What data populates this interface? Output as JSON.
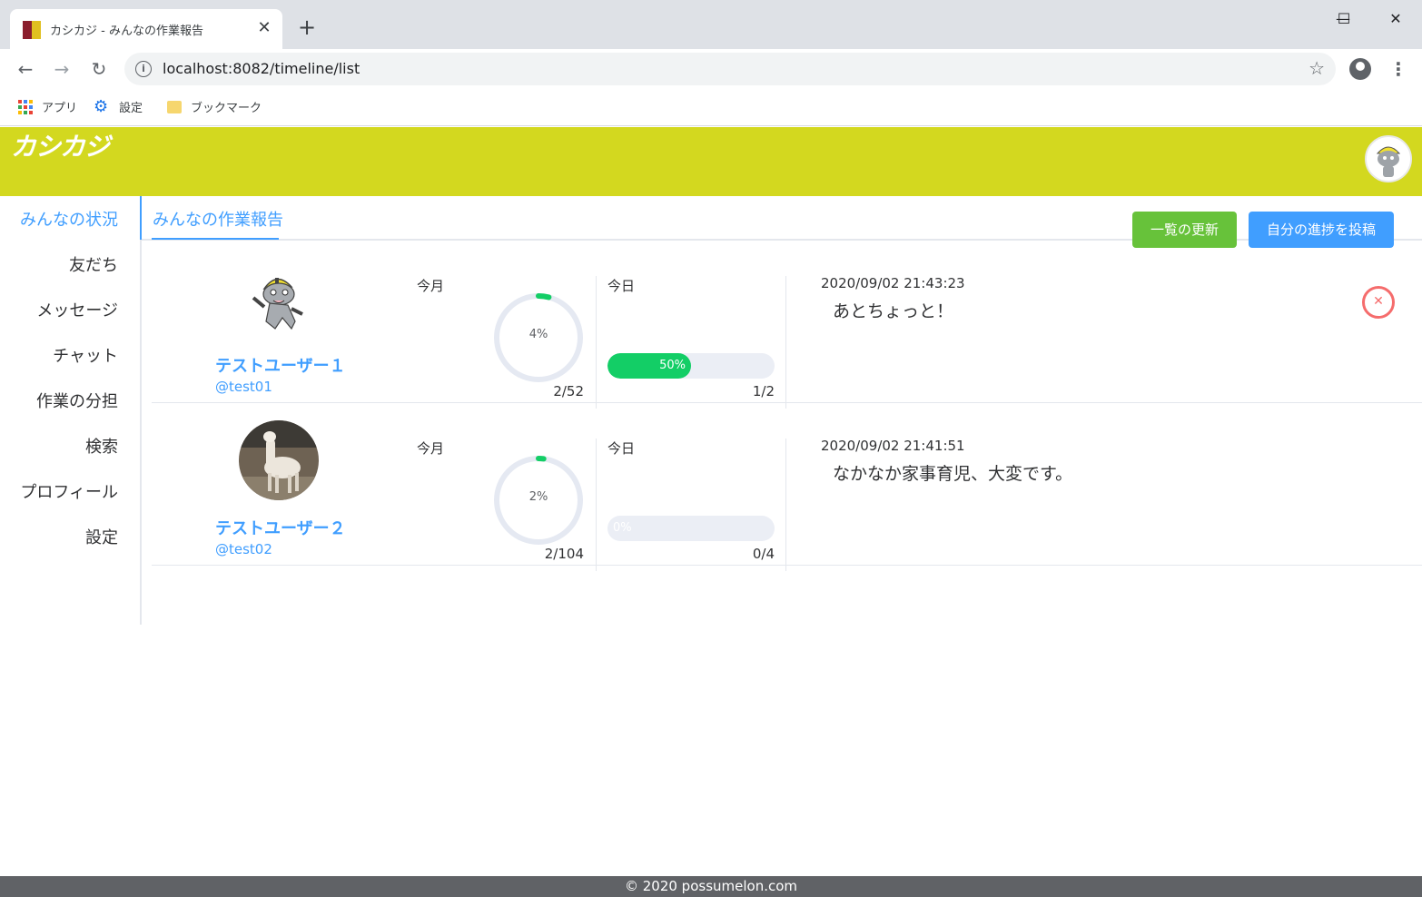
{
  "browser": {
    "tab_title": "カシカジ - みんなの作業報告",
    "tab_close": "✕",
    "new_tab": "+",
    "url": "localhost:8082/timeline/list",
    "window_controls": {
      "minimize": "—",
      "maximize": "☐",
      "close": "✕"
    },
    "nav": {
      "back": "←",
      "forward": "→",
      "reload": "↻"
    },
    "star": "☆",
    "bookmarks": [
      {
        "label": "アプリ",
        "icon": "apps-icon"
      },
      {
        "label": "設定",
        "icon": "gear-icon"
      },
      {
        "label": "ブックマーク",
        "icon": "folder-icon"
      }
    ]
  },
  "app": {
    "logo": "カシカジ",
    "header_color": "#d3d81f",
    "accent": "#409eff",
    "sidebar": [
      {
        "label": "みんなの状況",
        "active": true
      },
      {
        "label": "友だち"
      },
      {
        "label": "メッセージ"
      },
      {
        "label": "チャット"
      },
      {
        "label": "作業の分担"
      },
      {
        "label": "検索"
      },
      {
        "label": "プロフィール"
      },
      {
        "label": "設定"
      }
    ],
    "tab": "みんなの作業報告",
    "buttons": {
      "refresh": "一覧の更新",
      "post": "自分の進捗を投稿"
    },
    "reports": [
      {
        "name": "テストユーザー１",
        "id": "@test01",
        "month_label": "今月",
        "month_percent": 4,
        "month_percent_text": "4%",
        "month_count": "2/52",
        "day_label": "今日",
        "day_percent": 50,
        "day_percent_text": "50%",
        "day_count": "1/2",
        "timestamp": "2020/09/02 21:43:23",
        "message": "あとちょっと！",
        "deletable": true
      },
      {
        "name": "テストユーザー２",
        "id": "@test02",
        "month_label": "今月",
        "month_percent": 2,
        "month_percent_text": "2%",
        "month_count": "2/104",
        "day_label": "今日",
        "day_percent": 0,
        "day_percent_text": "0%",
        "day_count": "0/4",
        "timestamp": "2020/09/02 21:41:51",
        "message": "なかなか家事育児、大変です。",
        "deletable": false
      }
    ],
    "delete_icon": "✕",
    "footer": "© 2020 possumelon.com"
  }
}
